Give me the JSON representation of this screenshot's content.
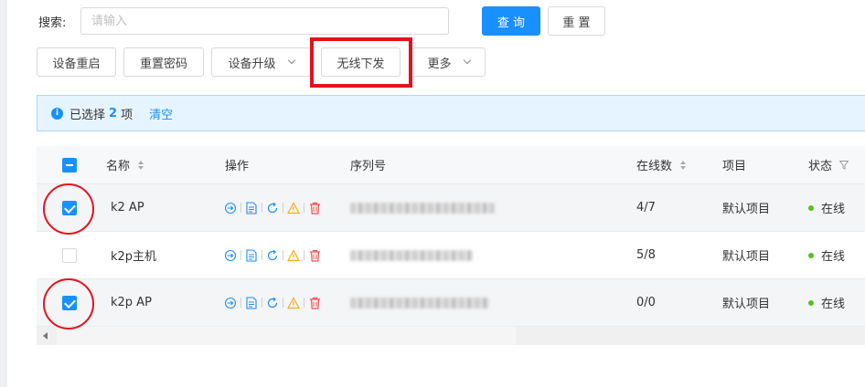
{
  "search": {
    "label": "搜索:",
    "placeholder": "请输入",
    "value": "",
    "query_label": "查 询",
    "reset_label": "重 置"
  },
  "toolbar": {
    "restart_label": "设备重启",
    "reset_password_label": "重置密码",
    "upgrade_label": "设备升级",
    "wireless_push_label": "无线下发",
    "more_label": "更多"
  },
  "selection_banner": {
    "prefix": "已选择",
    "count": "2",
    "suffix": "项",
    "clear_label": "清空"
  },
  "table": {
    "columns": {
      "name": "名称",
      "actions": "操作",
      "serial": "序列号",
      "online": "在线数",
      "project": "项目",
      "status": "状态"
    },
    "rows": [
      {
        "name": "k2 AP",
        "online": "4/7",
        "project": "默认项目",
        "status": "在线",
        "selected": true
      },
      {
        "name": "k2p主机",
        "online": "5/8",
        "project": "默认项目",
        "status": "在线",
        "selected": false
      },
      {
        "name": "k2p AP",
        "online": "0/0",
        "project": "默认项目",
        "status": "在线",
        "selected": true
      }
    ]
  },
  "colors": {
    "primary": "#1890ff",
    "highlight": "#e3131b",
    "online": "#52c41a",
    "delete": "#ff4d4f",
    "warning": "#faad14"
  }
}
